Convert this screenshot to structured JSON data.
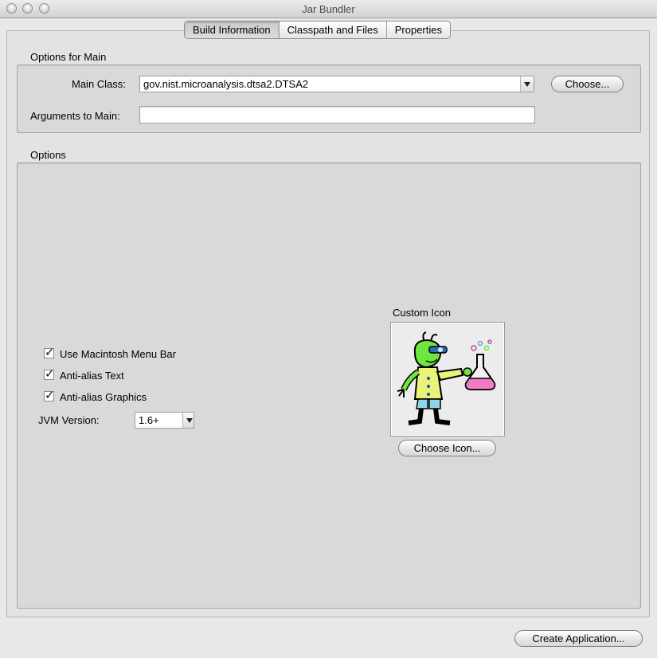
{
  "window": {
    "title": "Jar Bundler"
  },
  "tabs": [
    "Build Information",
    "Classpath and Files",
    "Properties"
  ],
  "main_options": {
    "group_title": "Options for Main",
    "main_class_label": "Main Class:",
    "main_class_value": "gov.nist.microanalysis.dtsa2.DTSA2",
    "choose_button": "Choose...",
    "arguments_label": "Arguments to Main:",
    "arguments_value": ""
  },
  "options": {
    "group_title": "Options",
    "checkboxes": [
      {
        "label": "Use Macintosh Menu Bar",
        "checked": true
      },
      {
        "label": "Anti-alias Text",
        "checked": true
      },
      {
        "label": "Anti-alias Graphics",
        "checked": true
      }
    ],
    "jvm_label": "JVM Version:",
    "jvm_value": "1.6+",
    "custom_icon_label": "Custom Icon",
    "choose_icon_button": "Choose Icon..."
  },
  "footer": {
    "create_button": "Create Application..."
  }
}
